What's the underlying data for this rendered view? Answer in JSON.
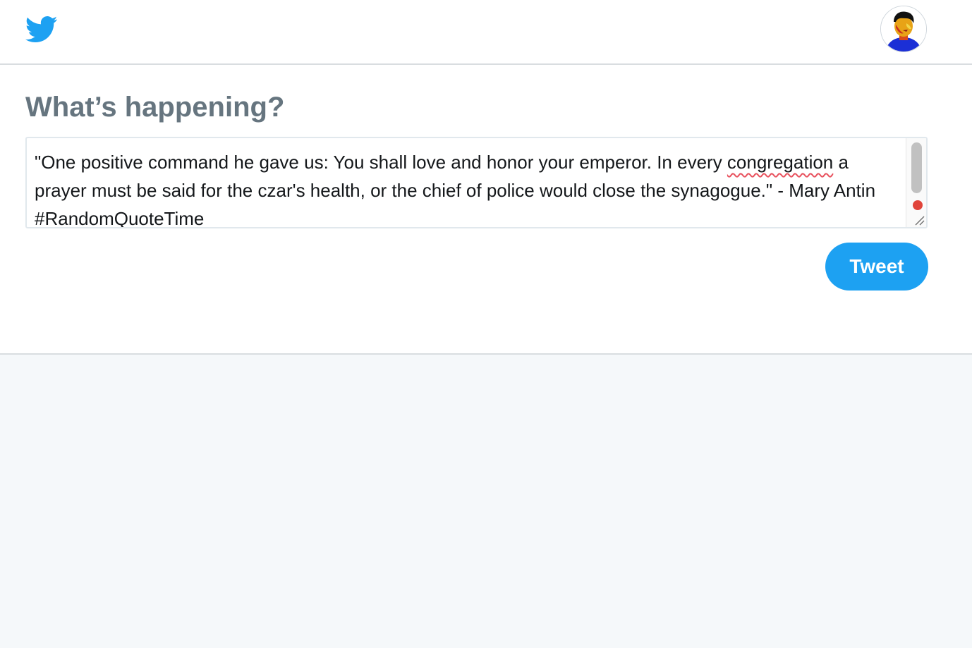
{
  "header": {
    "logo_icon": "twitter-bird-icon",
    "avatar_icon": "user-avatar",
    "brand_color": "#1da1f2"
  },
  "compose": {
    "heading": "What’s happening?",
    "tweet_text_before": "\"One positive command he gave us: You shall love and honor your emperor. In every ",
    "tweet_text_misspelled": "congregation",
    "tweet_text_after": " a prayer must be said for the czar's health, or the chief of police would close the synagogue.\" - Mary Antin #RandomQuoteTime",
    "tweet_button_label": "Tweet"
  },
  "colors": {
    "heading": "#66757f",
    "text": "#14171a",
    "spellcheck_underline": "#e8525e",
    "page_background": "#f5f8fa"
  }
}
